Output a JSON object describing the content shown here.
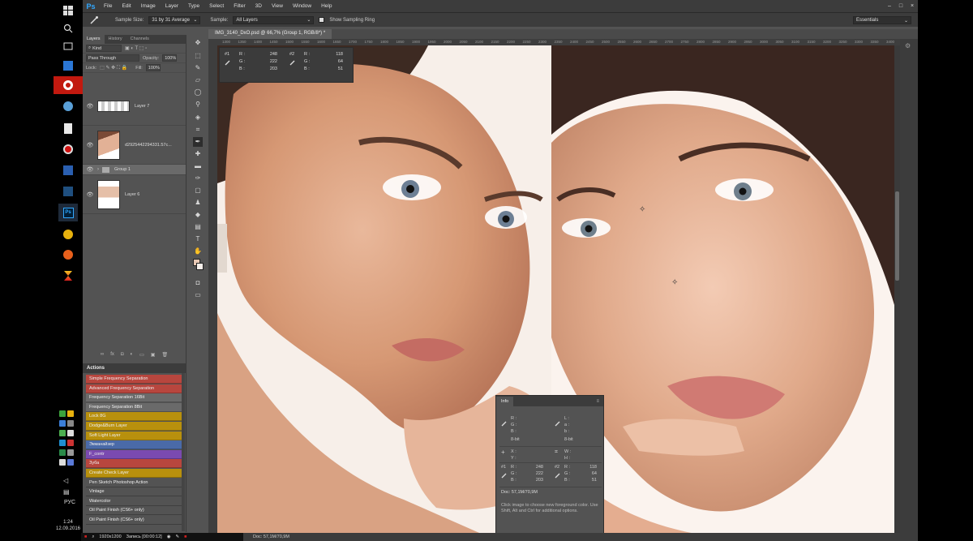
{
  "taskbar": {
    "language": "РУС",
    "time": "1:24",
    "date": "12.09.2016"
  },
  "app": {
    "logo": "Ps",
    "menu": [
      "File",
      "Edit",
      "Image",
      "Layer",
      "Type",
      "Select",
      "Filter",
      "3D",
      "View",
      "Window",
      "Help"
    ],
    "window_controls": [
      "–",
      "□",
      "×"
    ]
  },
  "options": {
    "sample_size_label": "Sample Size:",
    "sample_size_value": "31 by 31 Average",
    "sample_label": "Sample:",
    "sample_value": "All Layers",
    "sampling_ring_label": "Show Sampling Ring",
    "workspace": "Essentials"
  },
  "layers_panel": {
    "tabs": [
      "Layers",
      "History",
      "Channels"
    ],
    "filter": "Kind",
    "blend_mode": "Pass Through",
    "opacity_label": "Opacity:",
    "opacity_value": "100%",
    "lock_label": "Lock:",
    "fill_label": "Fill:",
    "fill_value": "100%",
    "layers": [
      {
        "name": "Layer 7"
      },
      {
        "name": "d2925442294331.57c..."
      },
      {
        "name": "Group 1"
      },
      {
        "name": "Layer 6"
      }
    ],
    "footer": [
      "∞",
      "fx",
      "◘",
      "◐",
      "▭",
      "▣",
      "🗑"
    ]
  },
  "actions_panel": {
    "title": "Actions",
    "items": [
      {
        "label": "Simple Frequency Separation",
        "color": "#b8463e"
      },
      {
        "label": "Advanced Frequency Separation",
        "color": "#b8463e"
      },
      {
        "label": "Frequency Separation 16Bit",
        "color": "#6a6a6a"
      },
      {
        "label": "Frequency Separation 8Bit",
        "color": "#6a6a6a"
      },
      {
        "label": "Lock 8G",
        "color": "#b8900d"
      },
      {
        "label": "Dodge&Burn Layer",
        "color": "#b8900d"
      },
      {
        "label": "Soft Light Layer",
        "color": "#b8900d"
      },
      {
        "label": "Экманайзер",
        "color": "#4a6aa8"
      },
      {
        "label": "F_contr",
        "color": "#7a4ab0"
      },
      {
        "label": "Зуба",
        "color": "#b8463e"
      },
      {
        "label": "Create Check Layer",
        "color": "#b8900d"
      },
      {
        "label": "Pen Sketch Photoshop Action",
        "color": "#535353"
      },
      {
        "label": "Vintage",
        "color": "#535353"
      },
      {
        "label": "Watercolor",
        "color": "#535353"
      },
      {
        "label": "Oil Paint Finish (CS6+ only)",
        "color": "#535353"
      },
      {
        "label": "Oil Paint Finish (CS6+ only)",
        "color": "#535353"
      }
    ]
  },
  "document": {
    "tab_title": "IMG_3140_DxO.psd @ 66,7% (Group 1, RGB/8*) *",
    "ruler_ticks": [
      "1300",
      "1350",
      "1400",
      "1450",
      "1500",
      "1550",
      "1600",
      "1650",
      "1700",
      "1750",
      "1800",
      "1850",
      "1900",
      "1950",
      "2000",
      "2050",
      "2100",
      "2150",
      "2200",
      "2250",
      "2300",
      "2350",
      "2400",
      "2450",
      "2500",
      "2550",
      "2600",
      "2650",
      "2700",
      "2750",
      "2800",
      "2850",
      "2900",
      "2950",
      "3000",
      "3050",
      "3100",
      "3150",
      "3200",
      "3250",
      "3300",
      "3350",
      "3400",
      "3450"
    ]
  },
  "readout": {
    "s1": {
      "id": "#1",
      "r_label": "R :",
      "g_label": "G :",
      "b_label": "B :",
      "r": "248",
      "g": "222",
      "b": "203"
    },
    "s2": {
      "id": "#2",
      "r_label": "R :",
      "g_label": "G :",
      "b_label": "B :",
      "r": "118",
      "g": "64",
      "b": "51"
    }
  },
  "info_panel": {
    "tab": "Info",
    "rgb_labels": "R :\nG :\nB :",
    "lab_labels": "L :\na :\nb :",
    "bit_depth_left": "8-bit",
    "bit_depth_right": "8-bit",
    "xy_labels": "X :\nY :",
    "wh_labels": "W :\nH :",
    "s1_label": "#1",
    "s1_values": "248\n222\n203",
    "s2_label": "#2",
    "s2_values": "118\n64\n51",
    "doc": "Doc: 57,1M/70,9M",
    "hint": "Click image to choose new foreground color. Use Shift, Alt and Ctrl for additional options."
  },
  "status": {
    "resolution": "1920x1200",
    "recording": "Запись [00:00:12]",
    "doc": "Doc: 57,1M/70,9M"
  }
}
